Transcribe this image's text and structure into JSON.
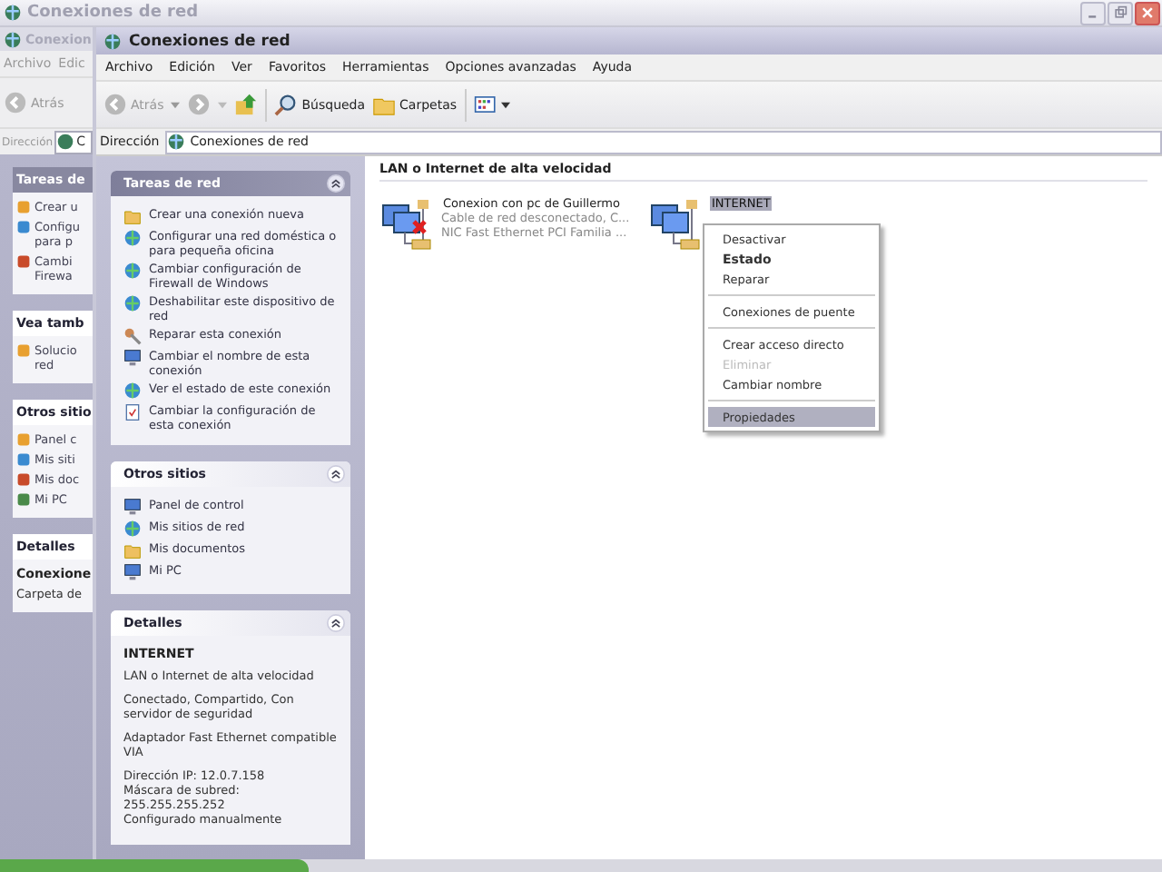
{
  "back_window": {
    "title": "Conexiones de red"
  },
  "middle_window": {
    "title": "Conexion",
    "menu": [
      "Archivo",
      "Edic"
    ],
    "back_button": "Atrás",
    "address_label": "Dirección",
    "address_value": "C",
    "panels": [
      {
        "title": "Tareas de",
        "items": [
          "Crear u",
          "Configu\npara p",
          "Cambi\nFirewa"
        ]
      },
      {
        "title": "Vea tamb",
        "items": [
          "Solucio\nred"
        ]
      },
      {
        "title": "Otros sitio",
        "items": [
          "Panel c",
          "Mis siti",
          "Mis doc",
          "Mi PC"
        ]
      },
      {
        "title": "Detalles",
        "heading": "Conexione",
        "text": "Carpeta de"
      }
    ]
  },
  "window": {
    "title": "Conexiones de red",
    "menu": [
      "Archivo",
      "Edición",
      "Ver",
      "Favoritos",
      "Herramientas",
      "Opciones avanzadas",
      "Ayuda"
    ],
    "toolbar": {
      "back": "Atrás",
      "search": "Búsqueda",
      "folders": "Carpetas"
    },
    "address": {
      "label": "Dirección",
      "value": "Conexiones de red"
    },
    "sidebar": [
      {
        "title": "Tareas de red",
        "items": [
          "Crear una conexión nueva",
          "Configurar una red doméstica o para pequeña oficina",
          "Cambiar configuración de Firewall de Windows",
          "Deshabilitar este dispositivo de red",
          "Reparar esta conexión",
          "Cambiar el nombre de esta conexión",
          "Ver el estado de este conexión",
          "Cambiar la configuración de esta conexión"
        ]
      },
      {
        "title": "Otros sitios",
        "items": [
          "Panel de control",
          "Mis sitios de red",
          "Mis documentos",
          "Mi PC"
        ]
      },
      {
        "title": "Detalles",
        "heading": "INTERNET",
        "paragraphs": [
          "LAN o Internet de alta velocidad",
          "Conectado, Compartido, Con servidor de seguridad",
          "Adaptador Fast Ethernet compatible VIA",
          "Dirección IP: 12.0.7.158\nMáscara de subred: 255.255.255.252\nConfigurado manualmente"
        ]
      }
    ],
    "group_title": "LAN o Internet de alta velocidad",
    "connections": [
      {
        "name": "Conexion con pc de Guillermo",
        "lines": [
          "Cable de red desconectado, C...",
          "NIC Fast Ethernet PCI Familia ..."
        ],
        "disconnected": true,
        "selected": false
      },
      {
        "name": "INTERNET",
        "disconnected": false,
        "selected": true
      }
    ],
    "context_menu": [
      {
        "kind": "item",
        "label": "Desactivar",
        "bold": false,
        "disabled": false,
        "selected": false
      },
      {
        "kind": "item",
        "label": "Estado",
        "bold": true,
        "disabled": false,
        "selected": false
      },
      {
        "kind": "item",
        "label": "Reparar",
        "bold": false,
        "disabled": false,
        "selected": false
      },
      {
        "kind": "separator"
      },
      {
        "kind": "item",
        "label": "Conexiones de puente",
        "bold": false,
        "disabled": false,
        "selected": false
      },
      {
        "kind": "separator"
      },
      {
        "kind": "item",
        "label": "Crear acceso directo",
        "bold": false,
        "disabled": false,
        "selected": false
      },
      {
        "kind": "item",
        "label": "Eliminar",
        "bold": false,
        "disabled": true,
        "selected": false
      },
      {
        "kind": "item",
        "label": "Cambiar nombre",
        "bold": false,
        "disabled": false,
        "selected": false
      },
      {
        "kind": "separator"
      },
      {
        "kind": "item",
        "label": "Propiedades",
        "bold": false,
        "disabled": false,
        "selected": true
      }
    ]
  }
}
